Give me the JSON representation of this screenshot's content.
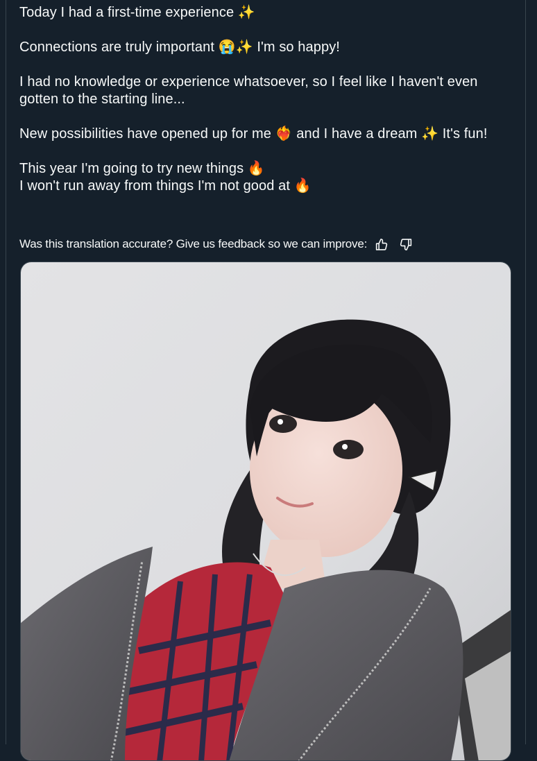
{
  "tweet": {
    "paragraphs": [
      [
        "Today I had a first-time experience ✨"
      ],
      [
        "Connections are truly important 😭✨ I'm so happy!"
      ],
      [
        "I had no knowledge or experience whatsoever, so I feel like I haven't even gotten to the starting line..."
      ],
      [
        "New possibilities have opened up for me ❤️‍🔥 and I have a dream ✨ It's fun!"
      ],
      [
        "This year I'm going to try new things 🔥",
        "I won't run away from things I'm not good at 🔥"
      ]
    ]
  },
  "translation_feedback": {
    "prompt": "Was this translation accurate? Give us feedback so we can improve:",
    "thumbs_up_icon": "thumbs-up-icon",
    "thumbs_down_icon": "thumbs-down-icon"
  },
  "media": {
    "type": "photo",
    "subject": "selfie"
  },
  "colors": {
    "background": "#15202b",
    "text": "#f7f9f9",
    "border": "#38444d"
  }
}
